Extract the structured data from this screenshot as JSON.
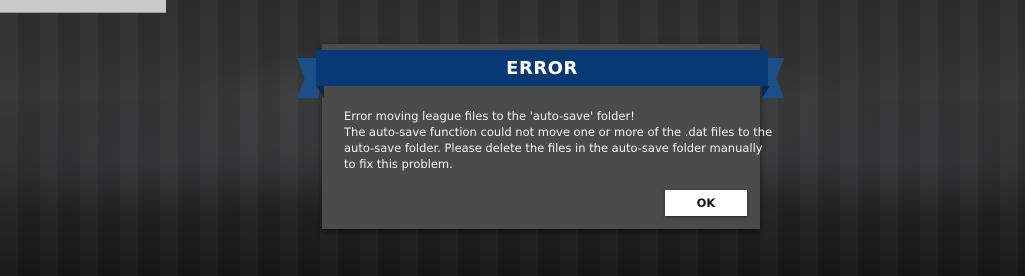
{
  "dialog": {
    "title": "ERROR",
    "message_lines": [
      "Error moving league files to the 'auto-save' folder!",
      "The auto-save function could not move one or more of the .dat files to the",
      "auto-save folder. Please delete the files in the auto-save folder manually",
      "to fix this problem."
    ],
    "ok_label": "OK"
  },
  "colors": {
    "banner": "#073a74",
    "ribbon_tail": "#1b4f88",
    "dialog_body": "#4a4b4b",
    "button_bg": "#ffffff"
  }
}
